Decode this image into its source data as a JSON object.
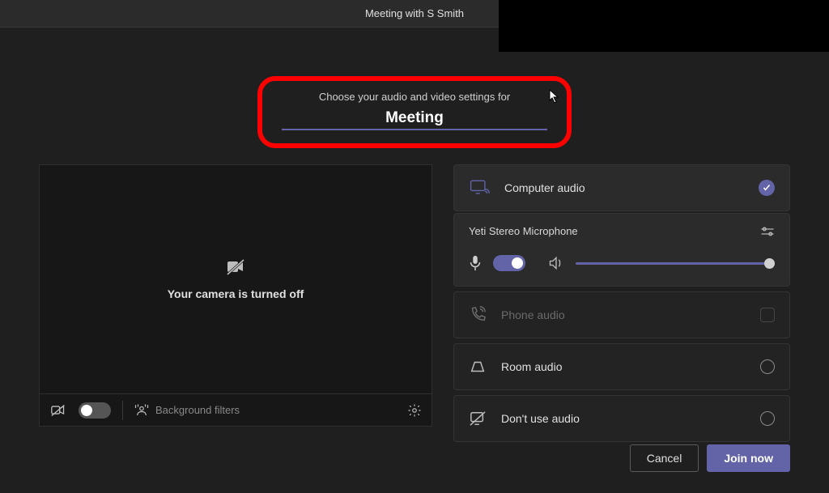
{
  "titlebar": {
    "title": "Meeting with S Smith"
  },
  "header": {
    "subtitle": "Choose your audio and video settings for",
    "meeting_name": "Meeting"
  },
  "camera": {
    "off_message": "Your camera is turned off",
    "background_filters_label": "Background filters"
  },
  "audio": {
    "device_name": "Yeti Stereo Microphone",
    "options": {
      "computer": "Computer audio",
      "phone": "Phone audio",
      "room": "Room audio",
      "none": "Don't use audio"
    }
  },
  "buttons": {
    "cancel": "Cancel",
    "join": "Join now"
  },
  "colors": {
    "accent": "#6264a7",
    "highlight": "#ff0000"
  }
}
